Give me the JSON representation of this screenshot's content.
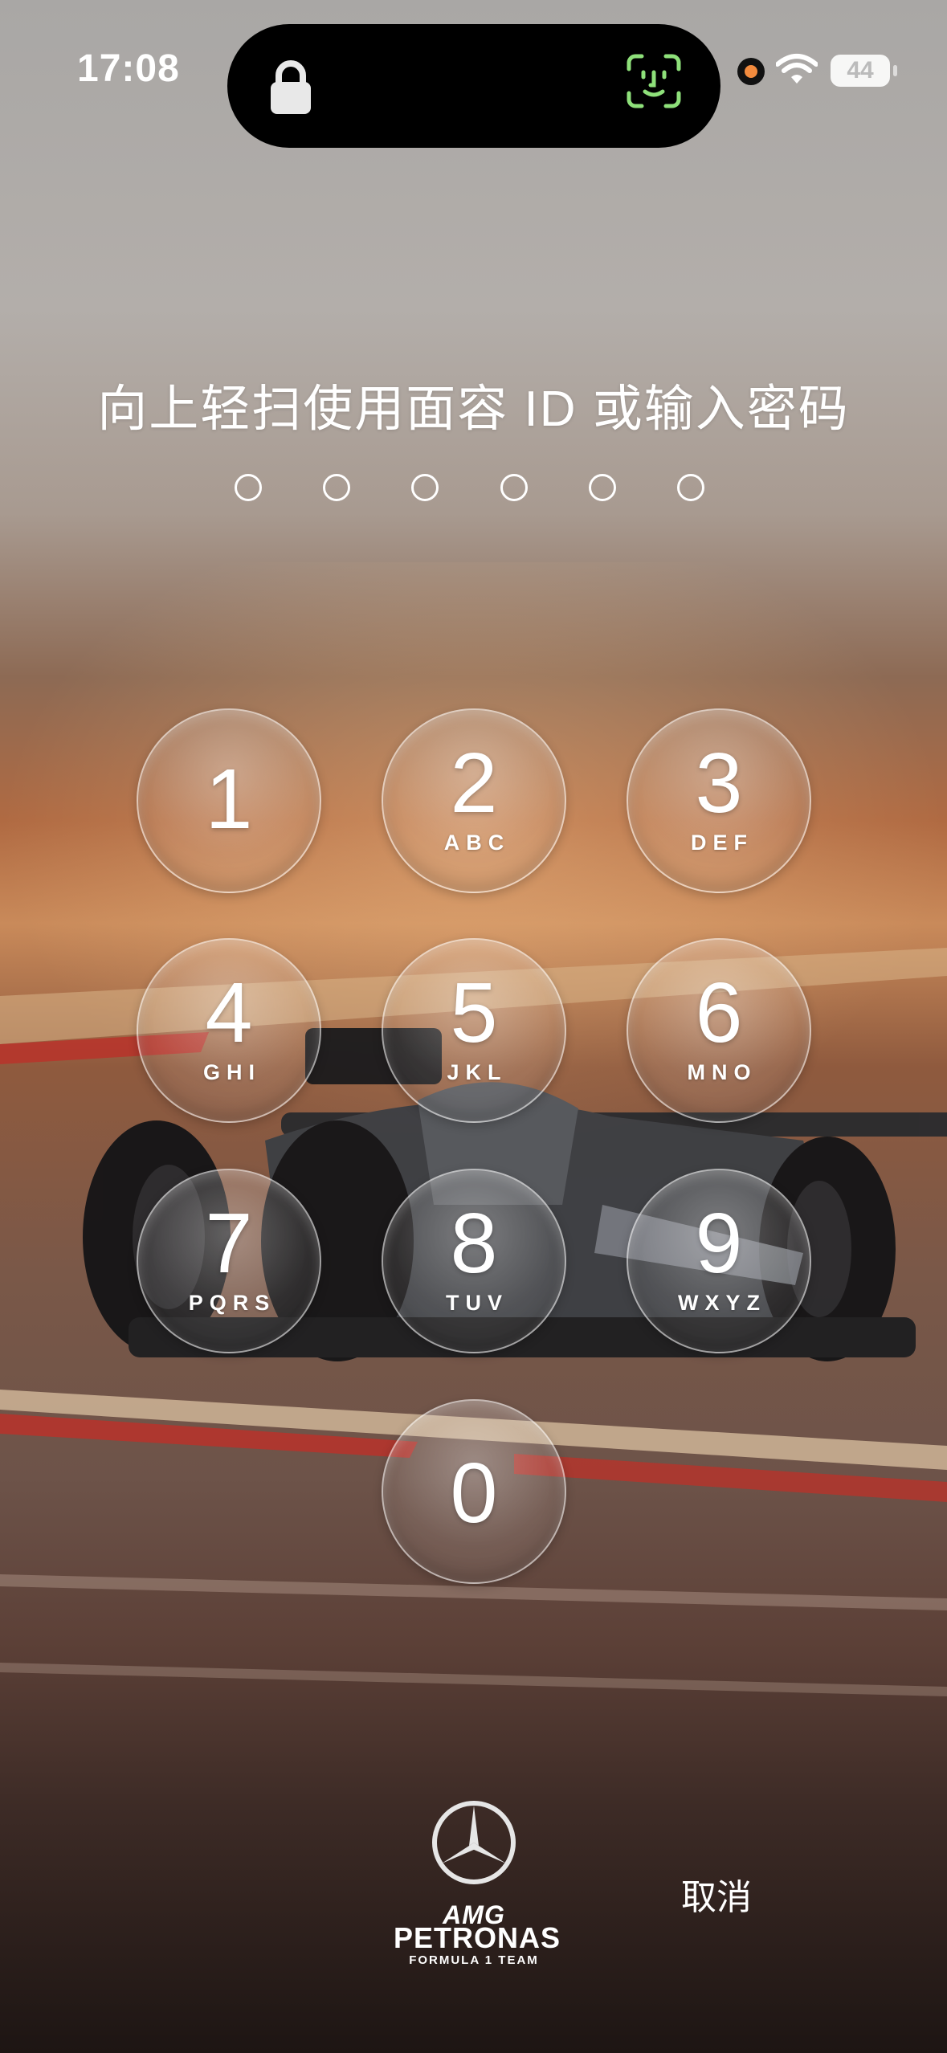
{
  "status_bar": {
    "time": "17:08",
    "battery": "44"
  },
  "lock_screen": {
    "prompt": "向上轻扫使用面容 ID 或输入密码",
    "passcode_length": 6,
    "cancel_label": "取消"
  },
  "keypad": {
    "keys": [
      {
        "digit": "1",
        "letters": ""
      },
      {
        "digit": "2",
        "letters": "ABC"
      },
      {
        "digit": "3",
        "letters": "DEF"
      },
      {
        "digit": "4",
        "letters": "GHI"
      },
      {
        "digit": "5",
        "letters": "JKL"
      },
      {
        "digit": "6",
        "letters": "MNO"
      },
      {
        "digit": "7",
        "letters": "PQRS"
      },
      {
        "digit": "8",
        "letters": "TUV"
      },
      {
        "digit": "9",
        "letters": "WXYZ"
      },
      {
        "digit": "0",
        "letters": ""
      }
    ]
  },
  "branding": {
    "amg": "AMG",
    "petronas": "PETRONAS",
    "team": "FORMULA 1 TEAM"
  },
  "colors": {
    "face_id": "#8ee07a",
    "recording_dot": "#f38b3e",
    "track_red": "#b8332a"
  }
}
